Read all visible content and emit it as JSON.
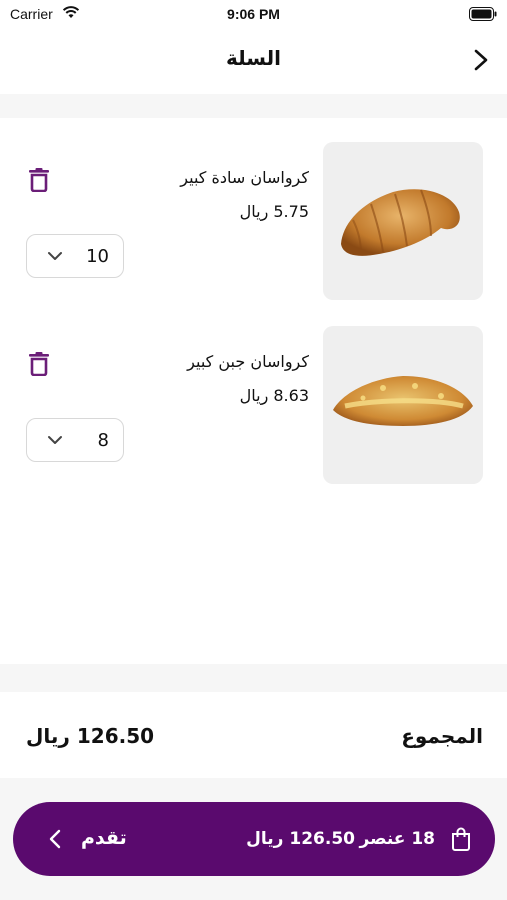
{
  "status_bar": {
    "carrier": "Carrier",
    "time": "9:06 PM"
  },
  "nav": {
    "title": "السلة",
    "back_icon": "chevron-right-icon"
  },
  "cart": {
    "items": [
      {
        "name": "كرواسان سادة كبير",
        "price": "5.75 ريال",
        "quantity": "10"
      },
      {
        "name": "كرواسان جبن كبير",
        "price": "8.63 ريال",
        "quantity": "8"
      }
    ]
  },
  "totals": {
    "label": "المجموع",
    "value": "126.50 ريال"
  },
  "checkout": {
    "item_count": "18 عنصر",
    "total": "126.50 ريال",
    "proceed_label": "تقدم",
    "icon": "shopping-bag-icon"
  },
  "colors": {
    "accent": "#5a0a6e",
    "delete_icon": "#6b1e78",
    "image_bg": "#efefef"
  }
}
